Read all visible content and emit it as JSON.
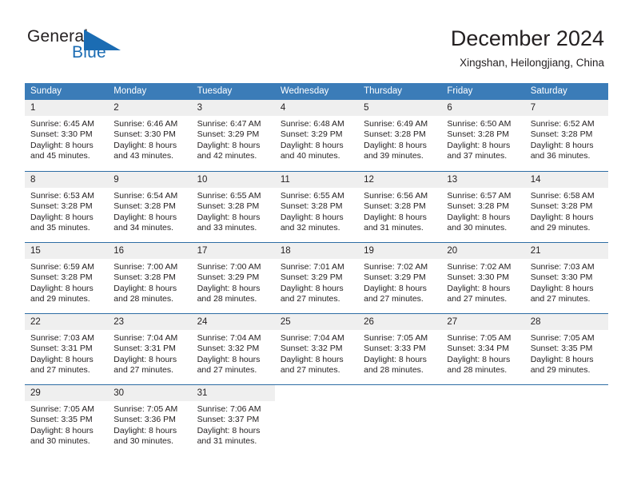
{
  "brand": {
    "name_part1": "General",
    "name_part2": "Blue",
    "triangle_icon": "blue-triangle-icon",
    "accent_color": "#1b6cb3"
  },
  "header": {
    "title": "December 2024",
    "subtitle": "Xingshan, Heilongjiang, China"
  },
  "theme": {
    "header_row_bg": "#3b7cb8",
    "row_divider": "#2e6da4",
    "day_number_bg": "#efefef",
    "text": "#231f20"
  },
  "weekdays": [
    "Sunday",
    "Monday",
    "Tuesday",
    "Wednesday",
    "Thursday",
    "Friday",
    "Saturday"
  ],
  "weeks": [
    [
      {
        "day": "1",
        "sunrise": "Sunrise: 6:45 AM",
        "sunset": "Sunset: 3:30 PM",
        "daylight1": "Daylight: 8 hours",
        "daylight2": "and 45 minutes."
      },
      {
        "day": "2",
        "sunrise": "Sunrise: 6:46 AM",
        "sunset": "Sunset: 3:30 PM",
        "daylight1": "Daylight: 8 hours",
        "daylight2": "and 43 minutes."
      },
      {
        "day": "3",
        "sunrise": "Sunrise: 6:47 AM",
        "sunset": "Sunset: 3:29 PM",
        "daylight1": "Daylight: 8 hours",
        "daylight2": "and 42 minutes."
      },
      {
        "day": "4",
        "sunrise": "Sunrise: 6:48 AM",
        "sunset": "Sunset: 3:29 PM",
        "daylight1": "Daylight: 8 hours",
        "daylight2": "and 40 minutes."
      },
      {
        "day": "5",
        "sunrise": "Sunrise: 6:49 AM",
        "sunset": "Sunset: 3:28 PM",
        "daylight1": "Daylight: 8 hours",
        "daylight2": "and 39 minutes."
      },
      {
        "day": "6",
        "sunrise": "Sunrise: 6:50 AM",
        "sunset": "Sunset: 3:28 PM",
        "daylight1": "Daylight: 8 hours",
        "daylight2": "and 37 minutes."
      },
      {
        "day": "7",
        "sunrise": "Sunrise: 6:52 AM",
        "sunset": "Sunset: 3:28 PM",
        "daylight1": "Daylight: 8 hours",
        "daylight2": "and 36 minutes."
      }
    ],
    [
      {
        "day": "8",
        "sunrise": "Sunrise: 6:53 AM",
        "sunset": "Sunset: 3:28 PM",
        "daylight1": "Daylight: 8 hours",
        "daylight2": "and 35 minutes."
      },
      {
        "day": "9",
        "sunrise": "Sunrise: 6:54 AM",
        "sunset": "Sunset: 3:28 PM",
        "daylight1": "Daylight: 8 hours",
        "daylight2": "and 34 minutes."
      },
      {
        "day": "10",
        "sunrise": "Sunrise: 6:55 AM",
        "sunset": "Sunset: 3:28 PM",
        "daylight1": "Daylight: 8 hours",
        "daylight2": "and 33 minutes."
      },
      {
        "day": "11",
        "sunrise": "Sunrise: 6:55 AM",
        "sunset": "Sunset: 3:28 PM",
        "daylight1": "Daylight: 8 hours",
        "daylight2": "and 32 minutes."
      },
      {
        "day": "12",
        "sunrise": "Sunrise: 6:56 AM",
        "sunset": "Sunset: 3:28 PM",
        "daylight1": "Daylight: 8 hours",
        "daylight2": "and 31 minutes."
      },
      {
        "day": "13",
        "sunrise": "Sunrise: 6:57 AM",
        "sunset": "Sunset: 3:28 PM",
        "daylight1": "Daylight: 8 hours",
        "daylight2": "and 30 minutes."
      },
      {
        "day": "14",
        "sunrise": "Sunrise: 6:58 AM",
        "sunset": "Sunset: 3:28 PM",
        "daylight1": "Daylight: 8 hours",
        "daylight2": "and 29 minutes."
      }
    ],
    [
      {
        "day": "15",
        "sunrise": "Sunrise: 6:59 AM",
        "sunset": "Sunset: 3:28 PM",
        "daylight1": "Daylight: 8 hours",
        "daylight2": "and 29 minutes."
      },
      {
        "day": "16",
        "sunrise": "Sunrise: 7:00 AM",
        "sunset": "Sunset: 3:28 PM",
        "daylight1": "Daylight: 8 hours",
        "daylight2": "and 28 minutes."
      },
      {
        "day": "17",
        "sunrise": "Sunrise: 7:00 AM",
        "sunset": "Sunset: 3:29 PM",
        "daylight1": "Daylight: 8 hours",
        "daylight2": "and 28 minutes."
      },
      {
        "day": "18",
        "sunrise": "Sunrise: 7:01 AM",
        "sunset": "Sunset: 3:29 PM",
        "daylight1": "Daylight: 8 hours",
        "daylight2": "and 27 minutes."
      },
      {
        "day": "19",
        "sunrise": "Sunrise: 7:02 AM",
        "sunset": "Sunset: 3:29 PM",
        "daylight1": "Daylight: 8 hours",
        "daylight2": "and 27 minutes."
      },
      {
        "day": "20",
        "sunrise": "Sunrise: 7:02 AM",
        "sunset": "Sunset: 3:30 PM",
        "daylight1": "Daylight: 8 hours",
        "daylight2": "and 27 minutes."
      },
      {
        "day": "21",
        "sunrise": "Sunrise: 7:03 AM",
        "sunset": "Sunset: 3:30 PM",
        "daylight1": "Daylight: 8 hours",
        "daylight2": "and 27 minutes."
      }
    ],
    [
      {
        "day": "22",
        "sunrise": "Sunrise: 7:03 AM",
        "sunset": "Sunset: 3:31 PM",
        "daylight1": "Daylight: 8 hours",
        "daylight2": "and 27 minutes."
      },
      {
        "day": "23",
        "sunrise": "Sunrise: 7:04 AM",
        "sunset": "Sunset: 3:31 PM",
        "daylight1": "Daylight: 8 hours",
        "daylight2": "and 27 minutes."
      },
      {
        "day": "24",
        "sunrise": "Sunrise: 7:04 AM",
        "sunset": "Sunset: 3:32 PM",
        "daylight1": "Daylight: 8 hours",
        "daylight2": "and 27 minutes."
      },
      {
        "day": "25",
        "sunrise": "Sunrise: 7:04 AM",
        "sunset": "Sunset: 3:32 PM",
        "daylight1": "Daylight: 8 hours",
        "daylight2": "and 27 minutes."
      },
      {
        "day": "26",
        "sunrise": "Sunrise: 7:05 AM",
        "sunset": "Sunset: 3:33 PM",
        "daylight1": "Daylight: 8 hours",
        "daylight2": "and 28 minutes."
      },
      {
        "day": "27",
        "sunrise": "Sunrise: 7:05 AM",
        "sunset": "Sunset: 3:34 PM",
        "daylight1": "Daylight: 8 hours",
        "daylight2": "and 28 minutes."
      },
      {
        "day": "28",
        "sunrise": "Sunrise: 7:05 AM",
        "sunset": "Sunset: 3:35 PM",
        "daylight1": "Daylight: 8 hours",
        "daylight2": "and 29 minutes."
      }
    ],
    [
      {
        "day": "29",
        "sunrise": "Sunrise: 7:05 AM",
        "sunset": "Sunset: 3:35 PM",
        "daylight1": "Daylight: 8 hours",
        "daylight2": "and 30 minutes."
      },
      {
        "day": "30",
        "sunrise": "Sunrise: 7:05 AM",
        "sunset": "Sunset: 3:36 PM",
        "daylight1": "Daylight: 8 hours",
        "daylight2": "and 30 minutes."
      },
      {
        "day": "31",
        "sunrise": "Sunrise: 7:06 AM",
        "sunset": "Sunset: 3:37 PM",
        "daylight1": "Daylight: 8 hours",
        "daylight2": "and 31 minutes."
      },
      {
        "day": "",
        "sunrise": "",
        "sunset": "",
        "daylight1": "",
        "daylight2": ""
      },
      {
        "day": "",
        "sunrise": "",
        "sunset": "",
        "daylight1": "",
        "daylight2": ""
      },
      {
        "day": "",
        "sunrise": "",
        "sunset": "",
        "daylight1": "",
        "daylight2": ""
      },
      {
        "day": "",
        "sunrise": "",
        "sunset": "",
        "daylight1": "",
        "daylight2": ""
      }
    ]
  ]
}
